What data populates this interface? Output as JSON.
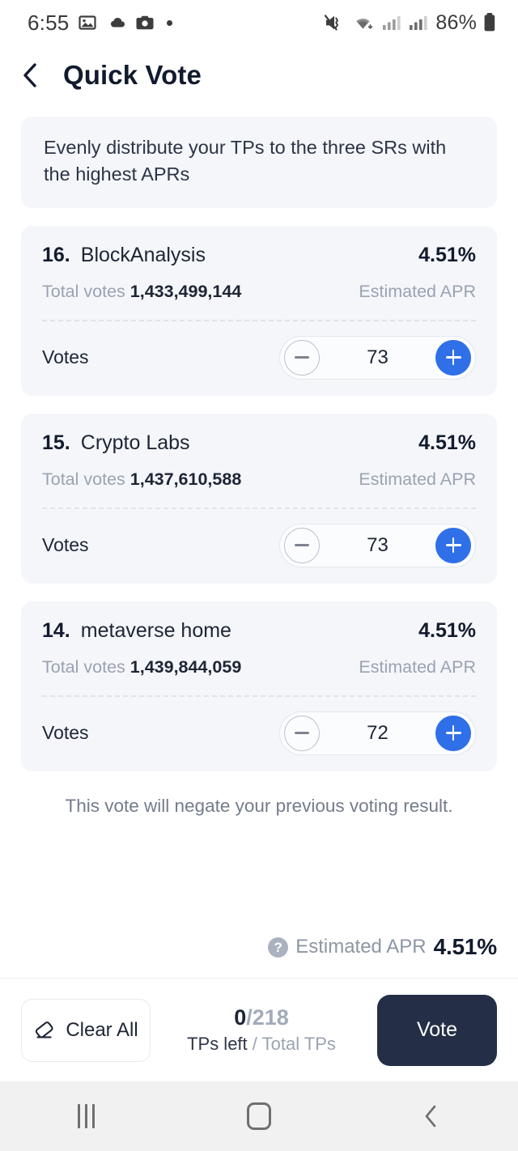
{
  "status_bar": {
    "time": "6:55",
    "left_icons": [
      "image-icon",
      "cloud-icon",
      "camera-icon",
      "dot-indicator"
    ],
    "right_icons": [
      "mute-vibrate-icon",
      "wifi-icon",
      "signal-bars-icon",
      "signal-bars-icon"
    ],
    "battery_text": "86%"
  },
  "header": {
    "back_icon": "chevron-left-icon",
    "title": "Quick Vote"
  },
  "notice": {
    "text": "Evenly distribute your TPs to the three SRs with the highest APRs"
  },
  "labels": {
    "total_votes": "Total votes",
    "estimated_apr": "Estimated APR",
    "votes": "Votes",
    "minus_icon": "minus-icon",
    "plus_icon": "plus-icon"
  },
  "cards": [
    {
      "rank": "16.",
      "name": "BlockAnalysis",
      "apr": "4.51%",
      "total_votes": "1,433,499,144",
      "votes": "73"
    },
    {
      "rank": "15.",
      "name": "Crypto Labs",
      "apr": "4.51%",
      "total_votes": "1,437,610,588",
      "votes": "73"
    },
    {
      "rank": "14.",
      "name": "metaverse home",
      "apr": "4.51%",
      "total_votes": "1,439,844,059",
      "votes": "72"
    }
  ],
  "negate_note": "This vote will negate your previous voting result.",
  "summary": {
    "help_icon": "question-mark-icon",
    "label": "Estimated APR",
    "value": "4.51%"
  },
  "action_bar": {
    "clear_icon": "eraser-icon",
    "clear_label": "Clear All",
    "tps_left": "0",
    "tps_separator": "/",
    "tps_total": "218",
    "caption_left": "TPs left",
    "caption_sep": " / ",
    "caption_right": "Total TPs",
    "vote_label": "Vote"
  },
  "nav_bar": {
    "recents_icon": "recents-icon",
    "home_icon": "home-icon",
    "back_icon": "back-icon"
  },
  "colors": {
    "accent_blue": "#2f6fe8",
    "dark_navy": "#242f47",
    "card_bg": "#f4f6f9",
    "muted_text": "#9aa3b2"
  }
}
